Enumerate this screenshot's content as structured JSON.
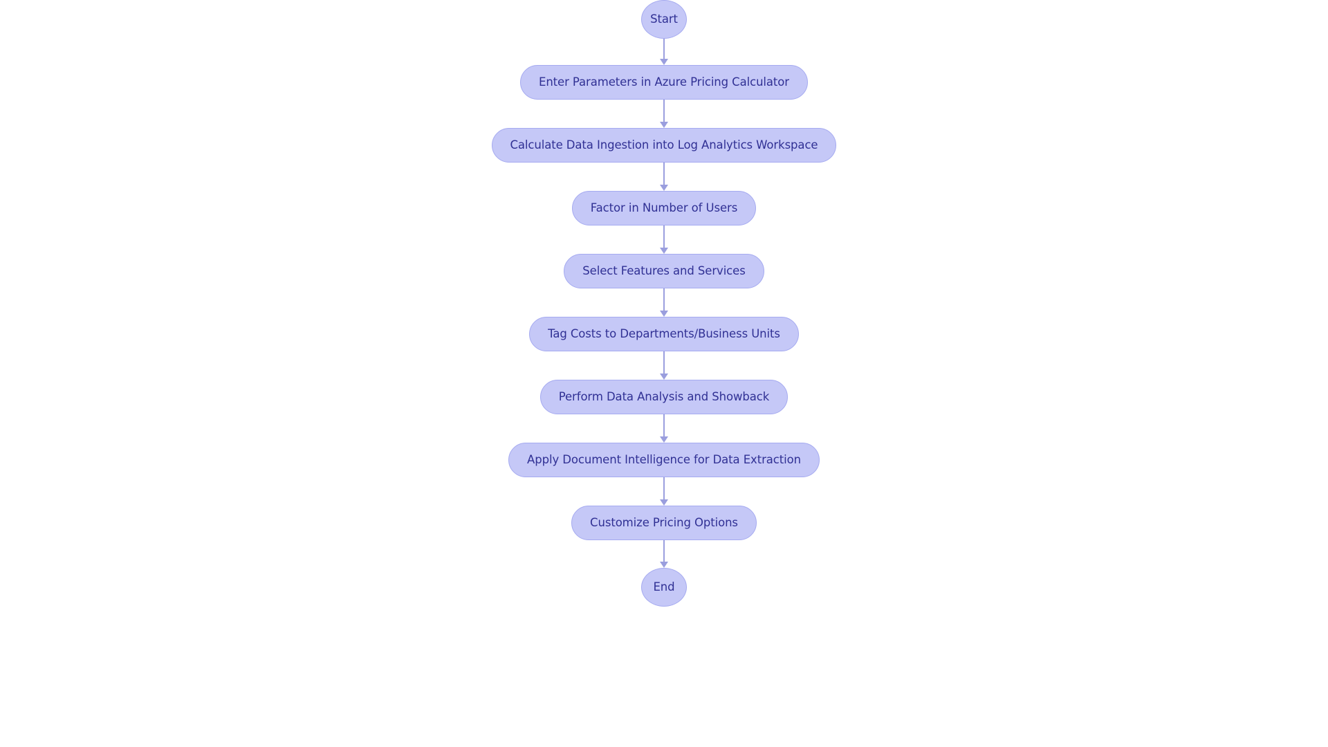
{
  "diagram": {
    "type": "flowchart",
    "orientation": "top-to-bottom",
    "title": "",
    "colors": {
      "node_fill": "#c5c8f7",
      "node_border": "#a5aaf0",
      "node_text": "#303094",
      "connector": "#9a9ede",
      "background": "#ffffff"
    },
    "nodes": [
      {
        "id": "start",
        "label": "Start",
        "shape": "ellipse"
      },
      {
        "id": "enter-params",
        "label": "Enter Parameters in Azure Pricing Calculator",
        "shape": "rounded-rect"
      },
      {
        "id": "calc-ingest",
        "label": "Calculate Data Ingestion into Log Analytics Workspace",
        "shape": "rounded-rect"
      },
      {
        "id": "factor-users",
        "label": "Factor in Number of Users",
        "shape": "rounded-rect"
      },
      {
        "id": "select-feat",
        "label": "Select Features and Services",
        "shape": "rounded-rect"
      },
      {
        "id": "tag-costs",
        "label": "Tag Costs to Departments/Business Units",
        "shape": "rounded-rect"
      },
      {
        "id": "data-analysis",
        "label": "Perform Data Analysis and Showback",
        "shape": "rounded-rect"
      },
      {
        "id": "doc-intel",
        "label": "Apply Document Intelligence for Data Extraction",
        "shape": "rounded-rect"
      },
      {
        "id": "customize",
        "label": "Customize Pricing Options",
        "shape": "rounded-rect"
      },
      {
        "id": "end",
        "label": "End",
        "shape": "ellipse"
      }
    ],
    "edges": [
      {
        "from": "start",
        "to": "enter-params",
        "label": ""
      },
      {
        "from": "enter-params",
        "to": "calc-ingest",
        "label": ""
      },
      {
        "from": "calc-ingest",
        "to": "factor-users",
        "label": ""
      },
      {
        "from": "factor-users",
        "to": "select-feat",
        "label": ""
      },
      {
        "from": "select-feat",
        "to": "tag-costs",
        "label": ""
      },
      {
        "from": "tag-costs",
        "to": "data-analysis",
        "label": ""
      },
      {
        "from": "data-analysis",
        "to": "doc-intel",
        "label": ""
      },
      {
        "from": "doc-intel",
        "to": "customize",
        "label": ""
      },
      {
        "from": "customize",
        "to": "end",
        "label": ""
      }
    ]
  }
}
